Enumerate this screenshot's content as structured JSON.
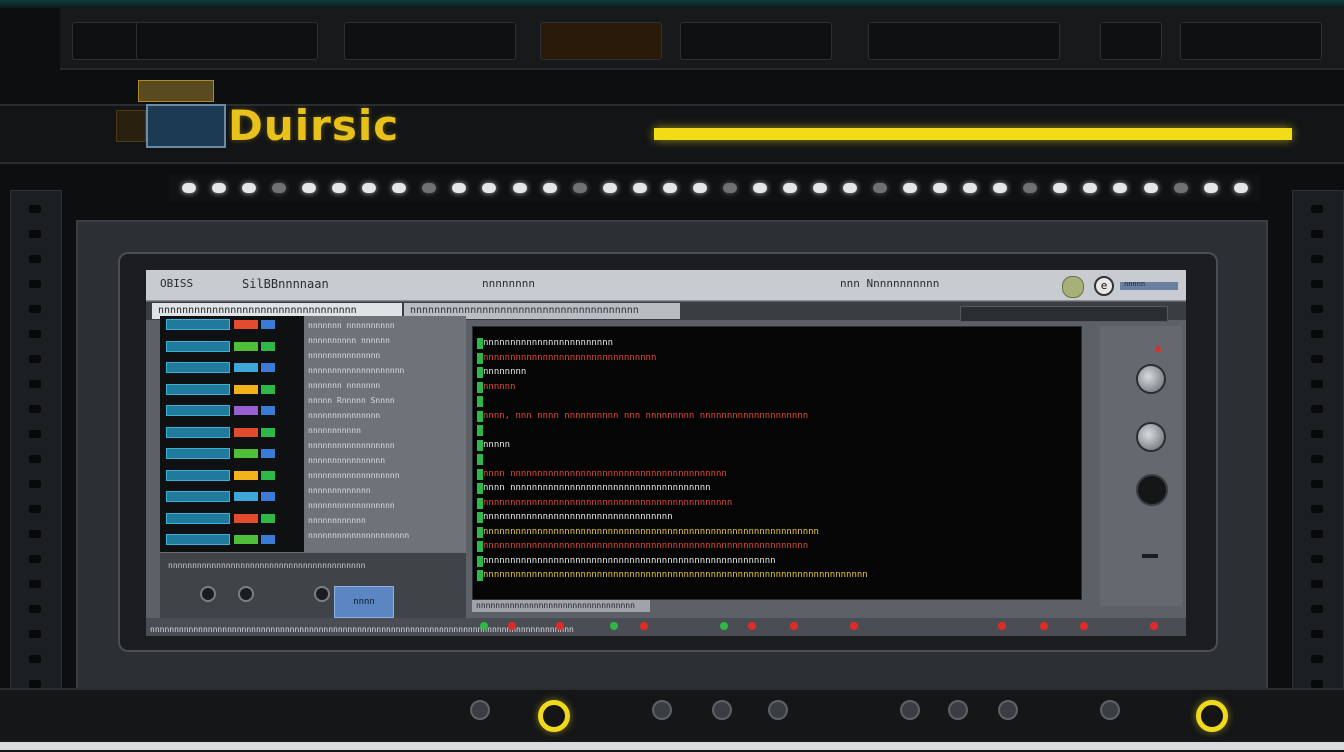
{
  "brand": {
    "wordmark": "Duirsic"
  },
  "titlebar": {
    "menu_left": "OBISS",
    "title": "SilBBnnnnaan",
    "center_text": "nnnnnnnn",
    "right_text": "nnn Nnnnnnnnnnn",
    "help_glyph": "e",
    "right_ctrl_text": "nnnnn"
  },
  "tabs": {
    "active": "nnnnnnnnnnnnnnnnnnnnnnnnnnnnnnnnn",
    "second": "nnnnnnnnnnnnnnnnnnnnnnnnnnnnnnnnnnnnnn"
  },
  "mid_panel": {
    "rows": [
      "nnnnnnn nnnnnnnnnn",
      "nnnnnnnnnn nnnnnn",
      "nnnnnnnnnnnnnnn",
      "nnnnnnnnnnnnnnnnnnnn",
      "nnnnnnn nnnnnnn",
      "nnnnn Rnnnnn Snnnn",
      "nnnnnnnnnnnnnnn",
      "nnnnnnnnnnn",
      "nnnnnnnnnnnnnnnnnn",
      "nnnnnnnnnnnnnnnn",
      "nnnnnnnnnnnnnnnnnnn",
      "nnnnnnnnnnnnn",
      "nnnnnnnnnnnnnnnnnn",
      "nnnnnnnnnnnn",
      "nnnnnnnnnnnnnnnnnnnnn"
    ]
  },
  "controls": {
    "label": "nnnnnnnnnnnnnnnnnnnnnnnnnnnnnnnnnnnnnnnnn",
    "button": "nnnn"
  },
  "terminal": {
    "lines": [
      {
        "text": "nnnnnnnnnnnnnnnnnnnnnnnn",
        "color": "#e9e9e9"
      },
      {
        "text": "nnnnnnnnnnnnnnnnnnnnnnnnnnnnnnnn",
        "color": "#e14a3a"
      },
      {
        "text": "nnnnnnnn",
        "color": "#e9e9e9"
      },
      {
        "text": "nnnnnn",
        "color": "#e14a3a"
      },
      {
        "text": "",
        "color": "#e9e9e9"
      },
      {
        "text": "nnnn, nnn nnnn nnnnnnnnnn nnn nnnnnnnnn nnnnnnnnnnnnnnnnnnnn",
        "color": "#e14a3a"
      },
      {
        "text": "",
        "color": "#e9e9e9"
      },
      {
        "text": "nnnnn",
        "color": "#e9e9e9"
      },
      {
        "text": "",
        "color": "#e9e9e9"
      },
      {
        "text": "nnnn nnnnnnnnnnnnnnnnnnnnnnnnnnnnnnnnnnnnnnnn",
        "color": "#e14a3a"
      },
      {
        "text": "nnnn nnnnnnnnnnnnnnnnnnnnnnnnnnnnnnnnnnnnn",
        "color": "#e9e9e9"
      },
      {
        "text": "nnnnnnnnnnnnnnnnnnnnnnnnnnnnnnnnnnnnnnnnnnnnnn",
        "color": "#e14a3a"
      },
      {
        "text": "nnnnnnnnnnnnnnnnnnnnnnnnnnnnnnnnnnn",
        "color": "#e9e9e9"
      },
      {
        "text": "nnnnnnnnnnnnnnnnnnnnnnnnnnnnnnnnnnnnnnnnnnnnnnnnnnnnnnnnnnnnnn",
        "color": "#e9c93a"
      },
      {
        "text": "nnnnnnnnnnnnnnnnnnnnnnnnnnnnnnnnnnnnnnnnnnnnnnnnnnnnnnnnnnnn",
        "color": "#e14a3a"
      },
      {
        "text": "nnnnnnnnnnnnnnnnnnnnnnnnnnnnnnnnnnnnnnnnnnnnnnnnnnnnnn",
        "color": "#e9e9e9"
      },
      {
        "text": "nnnnnnnnnnnnnnnnnnnnnnnnnnnnnnnnnnnnnnnnnnnnnnnnnnnnnnnnnnnnnnnnnnnnnnn",
        "color": "#e9c93a"
      }
    ],
    "status": "nnnnnnnnnnnnnnnnnnnnnnnnnnnnnnnnn"
  },
  "status_bar": {
    "text": "nnnnnnnnnnnnnnnnnnnnnnnnnnnnnnnnnnnnnnnnnnnnnnnnnnnnnnnnnnnnnnnnnnnnnnnnnnnnnnnnnnnnnnnn"
  },
  "colors": {
    "accent": "#f2dc18",
    "terminal_red": "#e14a3a",
    "terminal_green": "#2fb84a",
    "chip_blue": "#1f7a9c"
  },
  "icons": [
    "alert-icon",
    "help-icon",
    "power-icon"
  ]
}
